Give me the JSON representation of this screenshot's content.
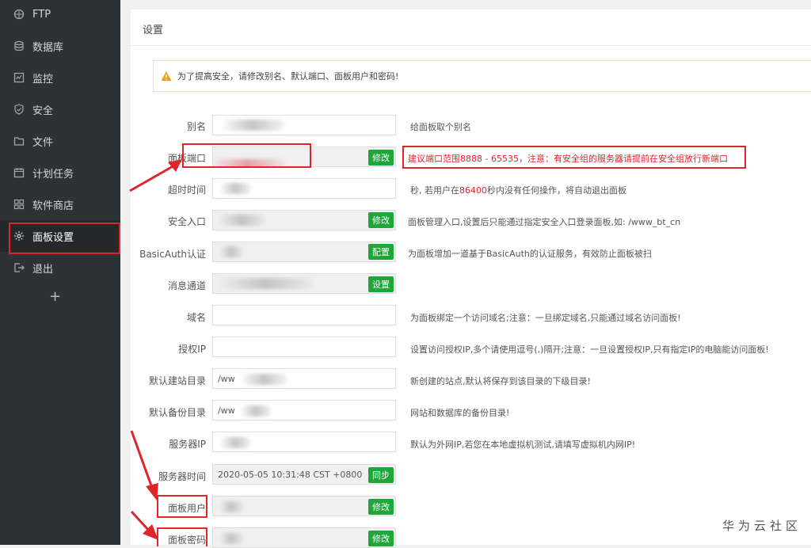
{
  "sidebar": {
    "items": [
      {
        "label": "FTP",
        "icon": "ftp-icon"
      },
      {
        "label": "数据库",
        "icon": "database-icon"
      },
      {
        "label": "监控",
        "icon": "monitor-icon"
      },
      {
        "label": "安全",
        "icon": "shield-icon"
      },
      {
        "label": "文件",
        "icon": "folder-icon"
      },
      {
        "label": "计划任务",
        "icon": "calendar-icon"
      },
      {
        "label": "软件商店",
        "icon": "apps-icon"
      },
      {
        "label": "面板设置",
        "icon": "gear-icon",
        "active": true
      },
      {
        "label": "退出",
        "icon": "logout-icon"
      }
    ],
    "add": "+"
  },
  "panel": {
    "title": "设置"
  },
  "alert": {
    "text": "为了提高安全，请修改别名、默认端口、面板用户和密码!"
  },
  "form": {
    "alias": {
      "label": "别名",
      "hint": "给面板取个别名"
    },
    "port": {
      "label": "面板端口",
      "button": "修改",
      "hint_prefix": "建议端口范围8888 - 65535，",
      "hint_warn": "注意：有安全组的服务器请提前在安全组放行新端口"
    },
    "timeout": {
      "label": "超时时间",
      "hint_a": "秒, 若用户在",
      "hint_num": "86400",
      "hint_b": "秒内没有任何操作，将自动退出面板"
    },
    "entry": {
      "label": "安全入口",
      "button": "修改",
      "hint": "面板管理入口,设置后只能通过指定安全入口登录面板,如: /www_bt_cn"
    },
    "basicauth": {
      "label": "BasicAuth认证",
      "button": "配置",
      "hint": "为面板增加一道基于BasicAuth的认证服务，有效防止面板被扫"
    },
    "message": {
      "label": "消息通道",
      "button": "设置"
    },
    "domain": {
      "label": "域名",
      "value": "",
      "hint": "为面板绑定一个访问域名;注意：一旦绑定域名,只能通过域名访问面板!"
    },
    "auth_ip": {
      "label": "授权IP",
      "value": "",
      "hint": "设置访问授权IP,多个请使用逗号(,)隔开;注意：一旦设置授权IP,只有指定IP的电脑能访问面板!"
    },
    "site_dir": {
      "label": "默认建站目录",
      "value": "/ww",
      "hint": "新创建的站点,默认将保存到该目录的下级目录!"
    },
    "backup_dir": {
      "label": "默认备份目录",
      "value": "/ww",
      "hint": "网站和数据库的备份目录!"
    },
    "server_ip": {
      "label": "服务器IP",
      "hint": "默认为外网IP,若您在本地虚拟机测试,请填写虚拟机内网IP!"
    },
    "server_time": {
      "label": "服务器时间",
      "value": "2020-05-05 10:31:48 CST +0800",
      "button": "同步"
    },
    "panel_user": {
      "label": "面板用户",
      "button": "修改"
    },
    "panel_pass": {
      "label": "面板密码",
      "button": "修改"
    }
  },
  "watermark": "华为云社区",
  "colors": {
    "accent": "#20a53a",
    "highlight": "#e0242b",
    "sidebar": "#2f3235"
  }
}
